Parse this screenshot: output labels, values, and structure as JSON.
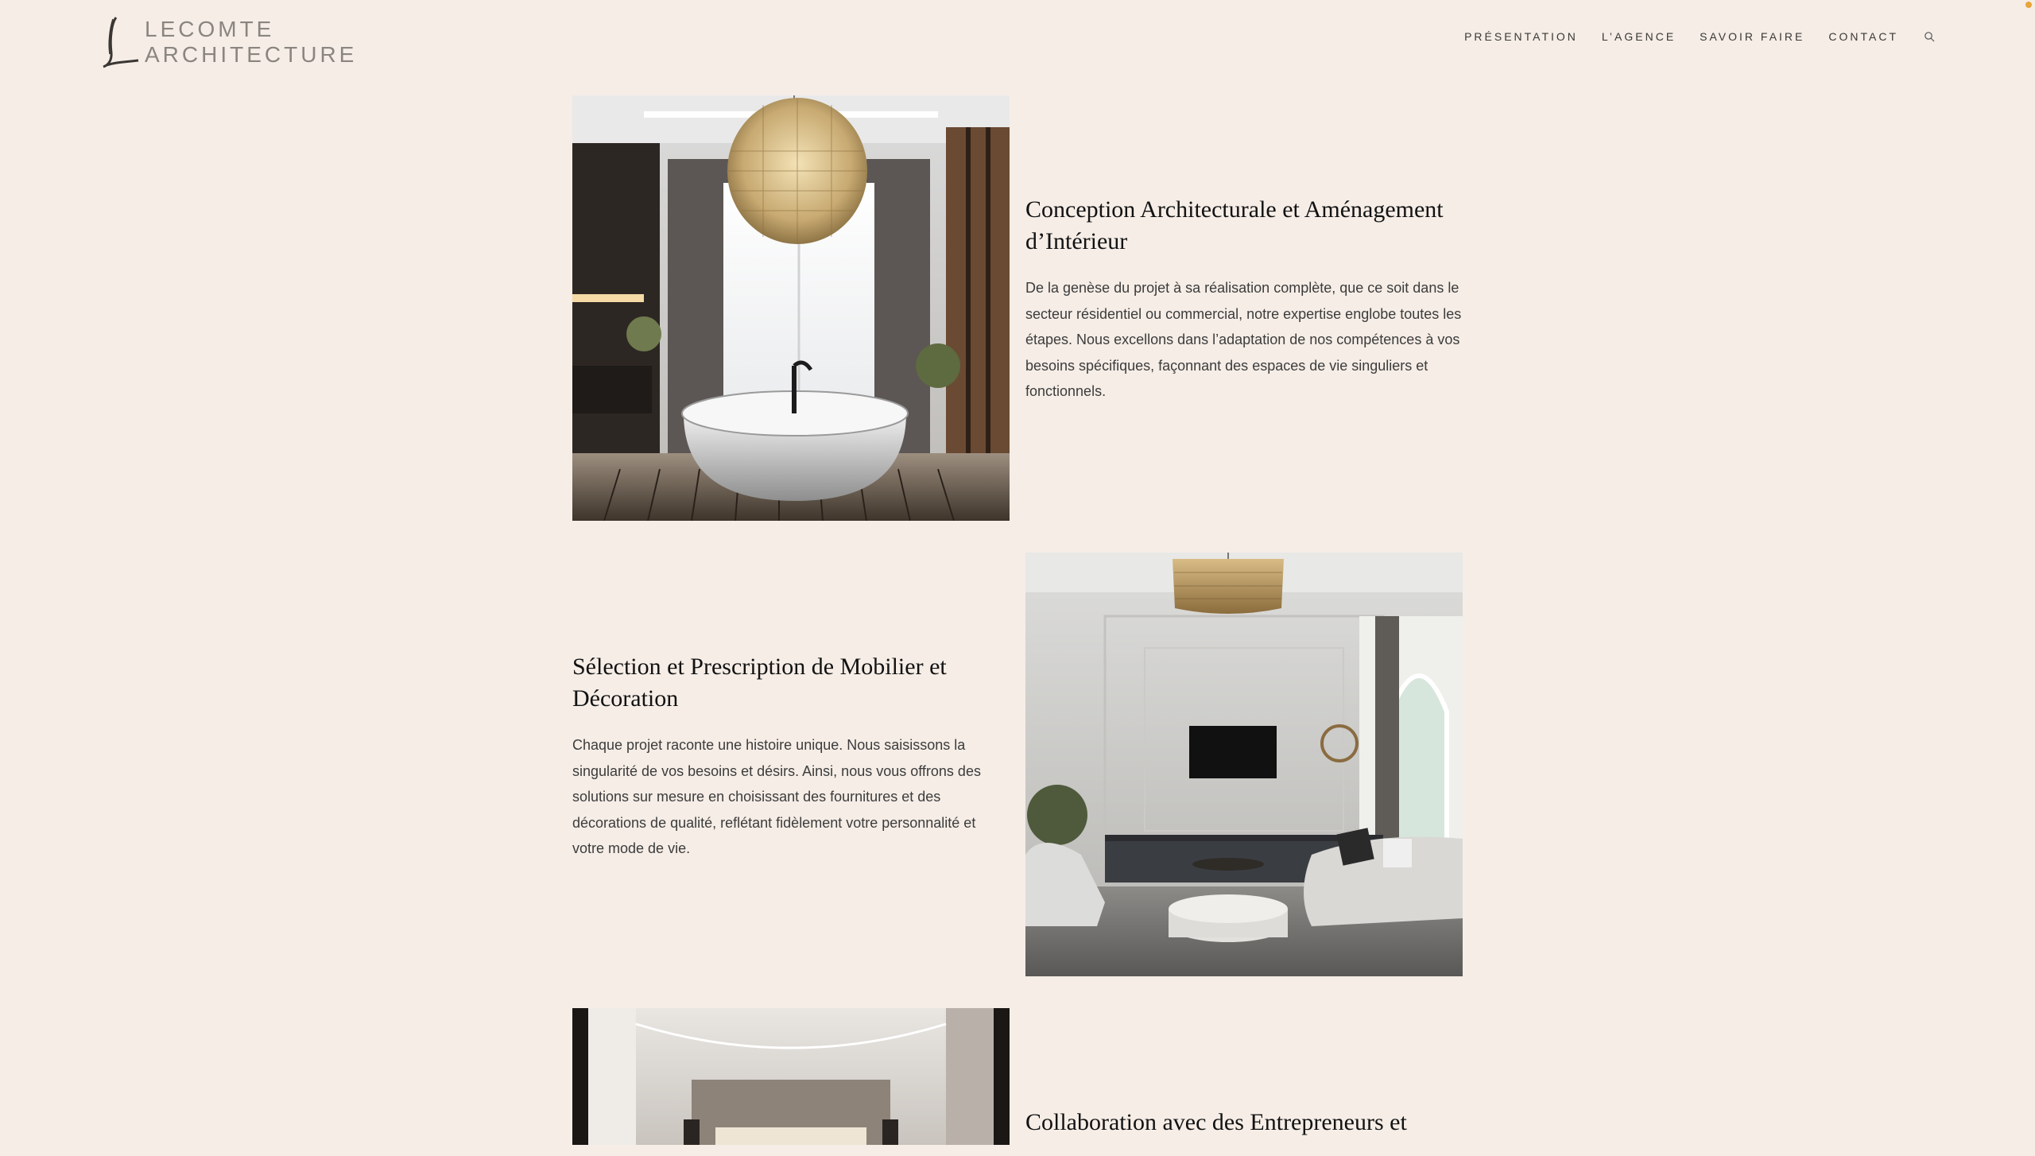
{
  "brand": {
    "line1": "LECOMTE",
    "line2": "ARCHITECTURE"
  },
  "nav": {
    "items": [
      "PRÉSENTATION",
      "L’AGENCE",
      "SAVOIR FAIRE",
      "CONTACT"
    ],
    "search_icon": "search-icon"
  },
  "sections": [
    {
      "title": "Conception Architecturale et Aménagement d’Intérieur",
      "text": "De la genèse du projet à sa réalisation complète, que ce soit dans le secteur résidentiel ou commercial, notre expertise englobe toutes les étapes. Nous excellons dans l’adaptation de nos compétences à vos besoins spécifiques, façonnant des espaces de vie singuliers et fonctionnels.",
      "image": "bathroom-photo"
    },
    {
      "title": "Sélection et Prescription de Mobilier et Décoration",
      "text": "Chaque projet raconte une histoire unique. Nous saisissons la singularité de vos besoins et désirs. Ainsi, nous vous offrons des solutions sur mesure en choisissant des fournitures et des décorations de qualité, reflétant fidèlement votre personnalité et votre mode de vie.",
      "image": "living-room-photo"
    },
    {
      "title": "Collaboration avec des Entrepreneurs et",
      "text": "",
      "image": "hallway-photo"
    }
  ],
  "colors": {
    "background": "#f5ede6",
    "text": "#2b2b2b",
    "logo": "#8a8580",
    "accent_dot": "#e8a53a"
  }
}
